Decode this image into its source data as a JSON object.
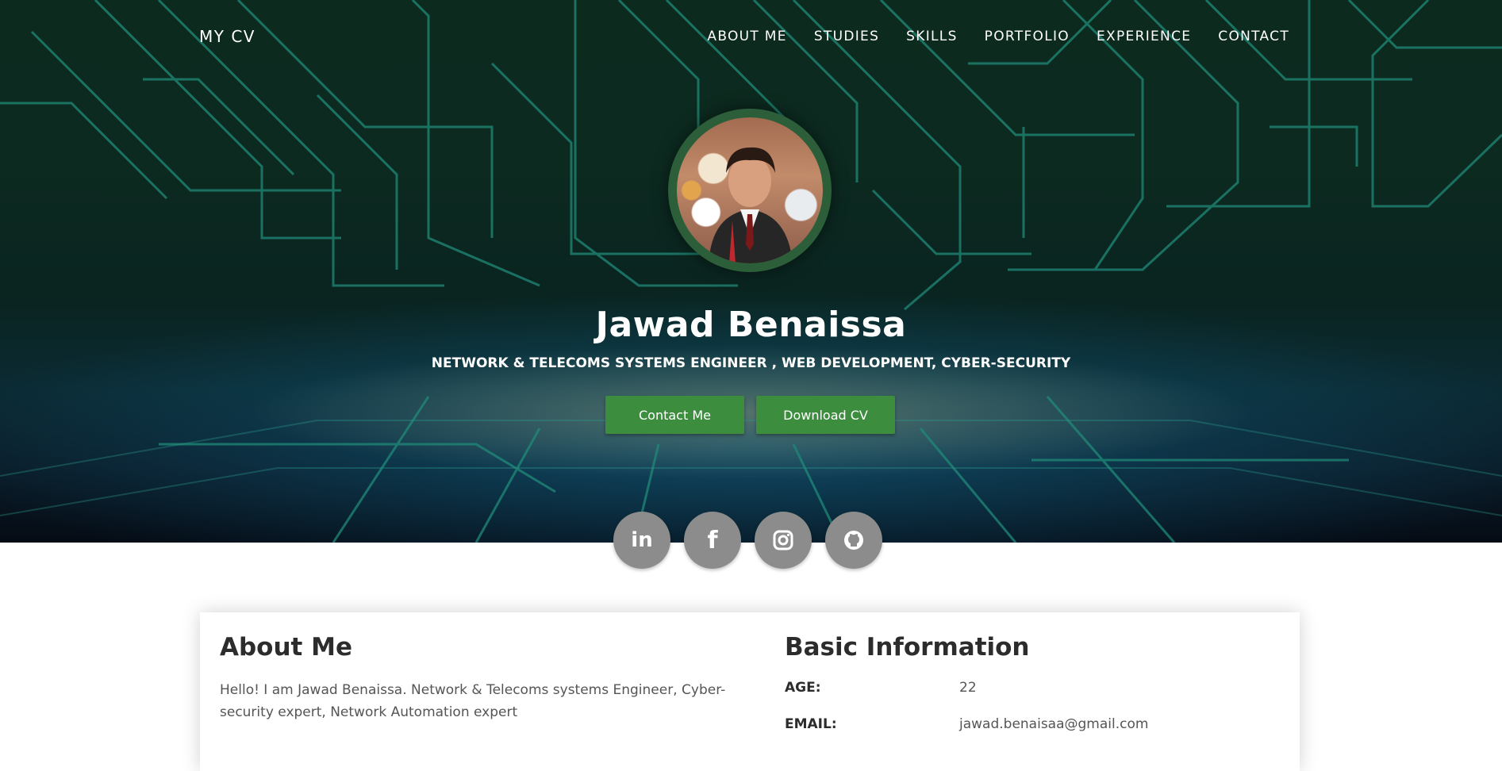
{
  "nav": {
    "brand": "MY CV",
    "items": [
      "ABOUT ME",
      "STUDIES",
      "SKILLS",
      "PORTFOLIO",
      "EXPERIENCE",
      "CONTACT"
    ]
  },
  "hero": {
    "name": "Jawad Benaissa",
    "subtitle": "NETWORK & TELECOMS SYSTEMS ENGINEER , WEB DEVELOPMENT, CYBER-SECURITY",
    "contact_button": "Contact Me",
    "download_button": "Download CV",
    "accent_color": "#3d8d3f"
  },
  "social": [
    {
      "icon": "linkedin-icon"
    },
    {
      "icon": "facebook-icon"
    },
    {
      "icon": "instagram-icon"
    },
    {
      "icon": "github-icon"
    }
  ],
  "about": {
    "title": "About Me",
    "text": "Hello! I am Jawad Benaissa. Network & Telecoms systems Engineer, Cyber-security expert, Network Automation expert"
  },
  "basic_info": {
    "title": "Basic Information",
    "rows": [
      {
        "label": "AGE:",
        "value": "22"
      },
      {
        "label": "EMAIL:",
        "value": "jawad.benaisaa@gmail.com"
      }
    ]
  }
}
